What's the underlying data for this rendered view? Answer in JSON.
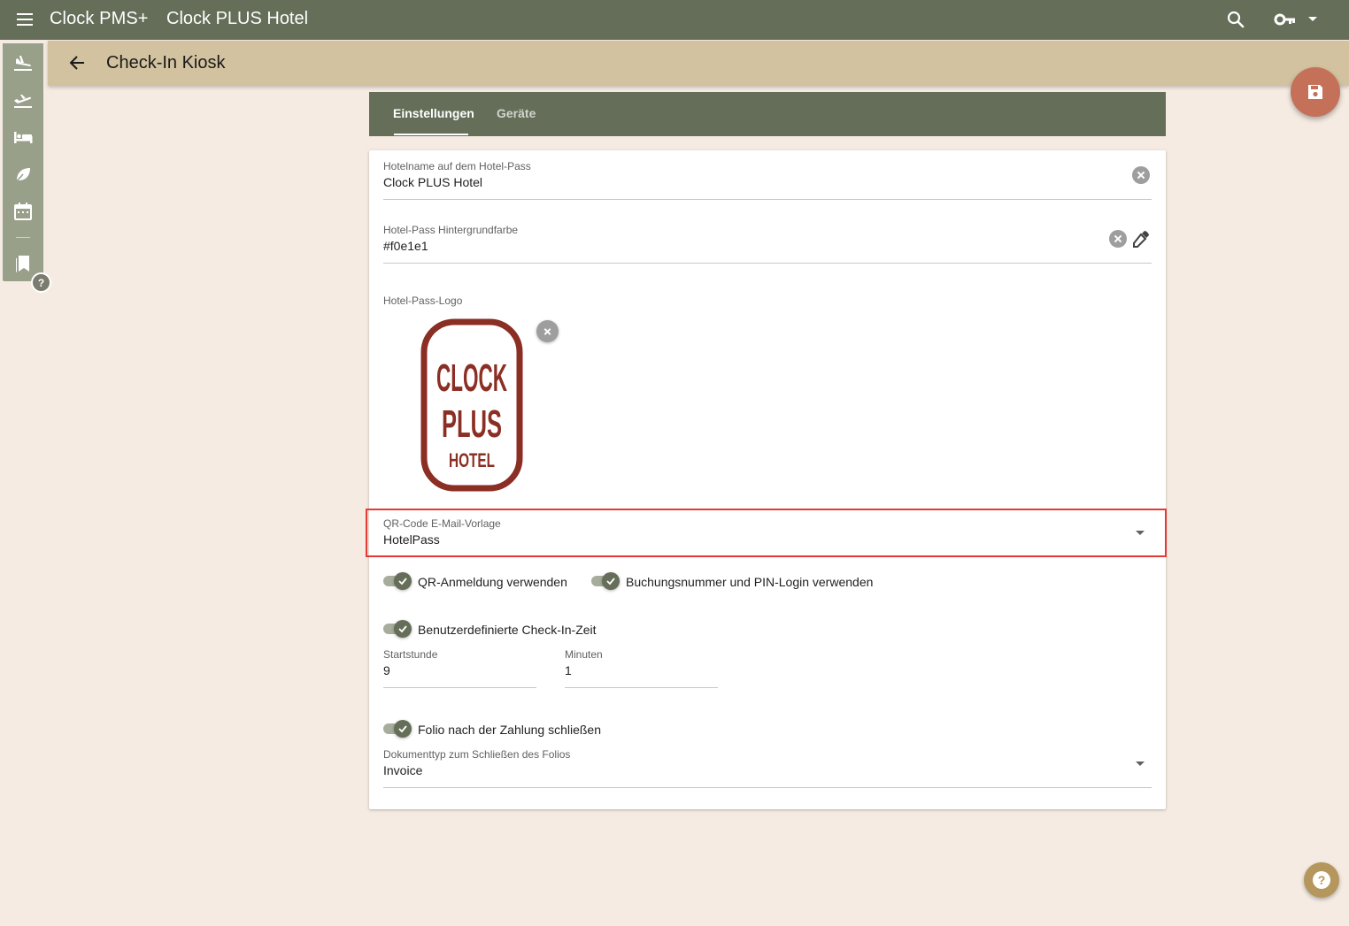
{
  "topbar": {
    "app_name": "Clock PMS+",
    "hotel_name": "Clock PLUS Hotel"
  },
  "header": {
    "title": "Check-In Kiosk"
  },
  "sidebar": {
    "items": [
      {
        "icon": "flight-land-icon"
      },
      {
        "icon": "flight-takeoff-icon"
      },
      {
        "icon": "bed-icon"
      },
      {
        "icon": "leaf-icon"
      },
      {
        "icon": "calendar-icon"
      },
      {
        "icon": "bookmarks-icon"
      }
    ],
    "help": "?"
  },
  "tabs": [
    {
      "label": "Einstellungen",
      "active": true
    },
    {
      "label": "Geräte",
      "active": false
    }
  ],
  "form": {
    "hotel_name": {
      "label": "Hotelname auf dem Hotel-Pass",
      "value": "Clock PLUS Hotel"
    },
    "bg_color": {
      "label": "Hotel-Pass Hintergrundfarbe",
      "value": "#f0e1e1"
    },
    "logo": {
      "label": "Hotel-Pass-Logo",
      "text_line1": "CLOCK",
      "text_line2": "PLUS",
      "text_line3": "HOTEL",
      "color": "#8b2e23"
    },
    "qr_template": {
      "label": "QR-Code E-Mail-Vorlage",
      "value": "HotelPass"
    },
    "toggles": {
      "qr_login": {
        "label": "QR-Anmeldung verwenden",
        "on": true
      },
      "pin_login": {
        "label": "Buchungsnummer und PIN-Login verwenden",
        "on": true
      },
      "custom_checkin": {
        "label": "Benutzerdefinierte Check-In-Zeit",
        "on": true
      },
      "close_folio": {
        "label": "Folio nach der Zahlung schließen",
        "on": true
      }
    },
    "start_hour": {
      "label": "Startstunde",
      "value": "9"
    },
    "minutes": {
      "label": "Minuten",
      "value": "1"
    },
    "doc_type": {
      "label": "Dokumenttyp zum Schließen des Folios",
      "value": "Invoice"
    }
  },
  "colors": {
    "primary": "#656e58",
    "accent": "#d2c29f",
    "fab": "#c5715a",
    "background": "#f5ebe2"
  }
}
